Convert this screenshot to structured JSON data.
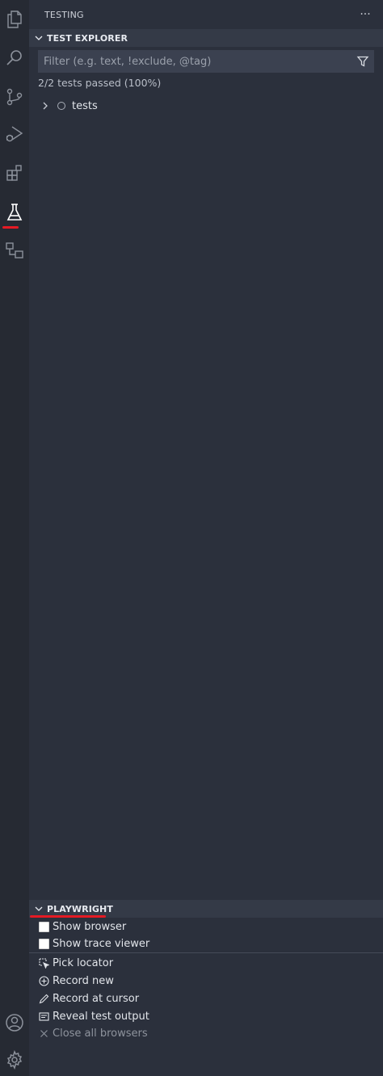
{
  "activity_bar": {
    "icons": [
      "explorer-icon",
      "search-icon",
      "source-control-icon",
      "run-debug-icon",
      "extensions-icon",
      "testing-icon",
      "remote-explorer-icon"
    ],
    "bottom_icons": [
      "account-icon",
      "settings-gear-icon"
    ],
    "active": "testing-icon",
    "accent_color": "#e51a24"
  },
  "sidebar": {
    "title": "TESTING",
    "more_label": "···"
  },
  "test_explorer": {
    "header": "TEST EXPLORER",
    "filter_placeholder": "Filter (e.g. text, !exclude, @tag)",
    "summary": "2/2 tests passed (100%)",
    "tree": [
      {
        "label": "tests",
        "expanded": false
      }
    ]
  },
  "playwright": {
    "header": "PLAYWRIGHT",
    "checkboxes": [
      {
        "label": "Show browser",
        "checked": false
      },
      {
        "label": "Show trace viewer",
        "checked": false
      }
    ],
    "actions": [
      {
        "label": "Pick locator",
        "icon": "pick-locator-icon",
        "enabled": true
      },
      {
        "label": "Record new",
        "icon": "record-new-icon",
        "enabled": true
      },
      {
        "label": "Record at cursor",
        "icon": "pencil-icon",
        "enabled": true
      },
      {
        "label": "Reveal test output",
        "icon": "output-icon",
        "enabled": true
      },
      {
        "label": "Close all browsers",
        "icon": "close-icon",
        "enabled": false
      }
    ]
  }
}
